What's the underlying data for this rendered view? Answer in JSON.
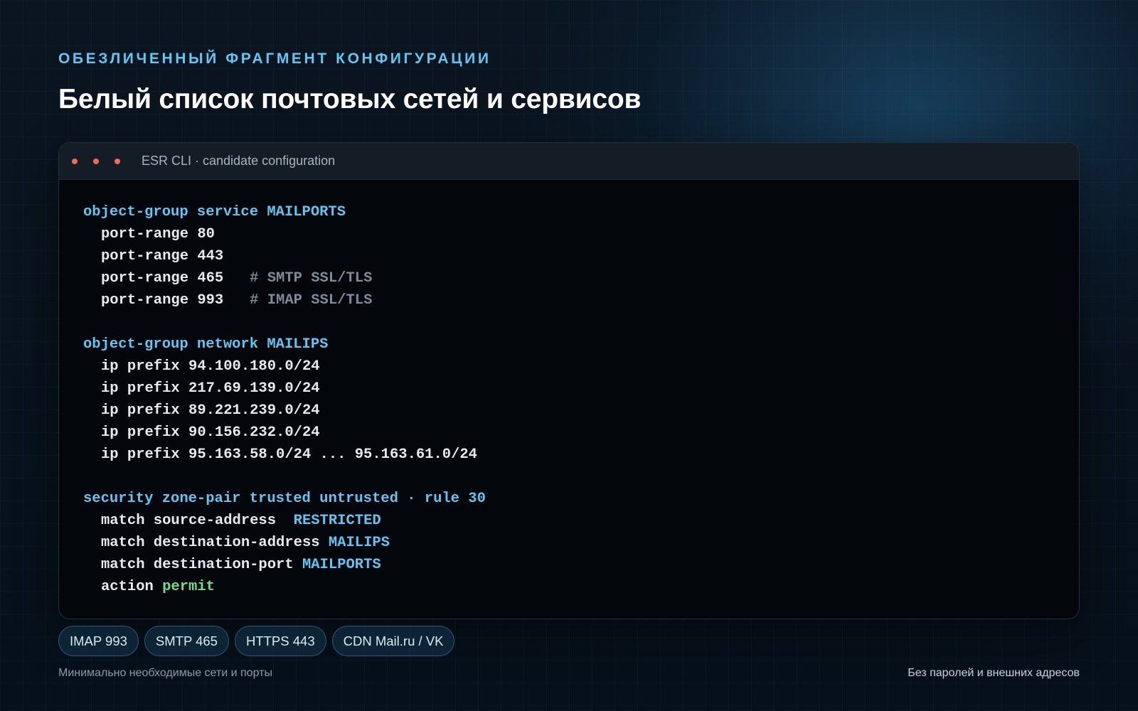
{
  "header": {
    "eyebrow": "ОБЕЗЛИЧЕННЫЙ ФРАГМЕНТ КОНФИГУРАЦИИ",
    "title": "Белый список почтовых сетей и сервисов"
  },
  "terminal": {
    "title": "ESR CLI · candidate configuration",
    "code": {
      "svc_group": "object-group service MAILPORTS",
      "port_80": "port-range 80",
      "port_443": "port-range 443",
      "port_465": "port-range 465   ",
      "port_465_comment": "# SMTP SSL/TLS",
      "port_993": "port-range 993   ",
      "port_993_comment": "# IMAP SSL/TLS",
      "net_group": "object-group network MAILIPS",
      "prefix_1": "ip prefix 94.100.180.0/24",
      "prefix_2": "ip prefix 217.69.139.0/24",
      "prefix_3": "ip prefix 89.221.239.0/24",
      "prefix_4": "ip prefix 90.156.232.0/24",
      "prefix_5": "ip prefix 95.163.58.0/24 ... 95.163.61.0/24",
      "zone_pair": "security zone-pair trusted untrusted · rule 30",
      "match_src": "match source-address  ",
      "match_src_val": "RESTRICTED",
      "match_dst": "match destination-address ",
      "match_dst_val": "MAILIPS",
      "match_port": "match destination-port ",
      "match_port_val": "MAILPORTS",
      "action": "action ",
      "action_val": "permit"
    }
  },
  "pills": [
    "IMAP 993",
    "SMTP 465",
    "HTTPS 443",
    "CDN Mail.ru / VK"
  ],
  "footer": {
    "left": "Минимально необходимые сети и порты",
    "right": "Без паролей и внешних адресов"
  },
  "colors": {
    "accent": "#63c6f0",
    "comment": "#7f8b97",
    "permit": "#6fdf8c",
    "dot": "#f06a5a"
  }
}
